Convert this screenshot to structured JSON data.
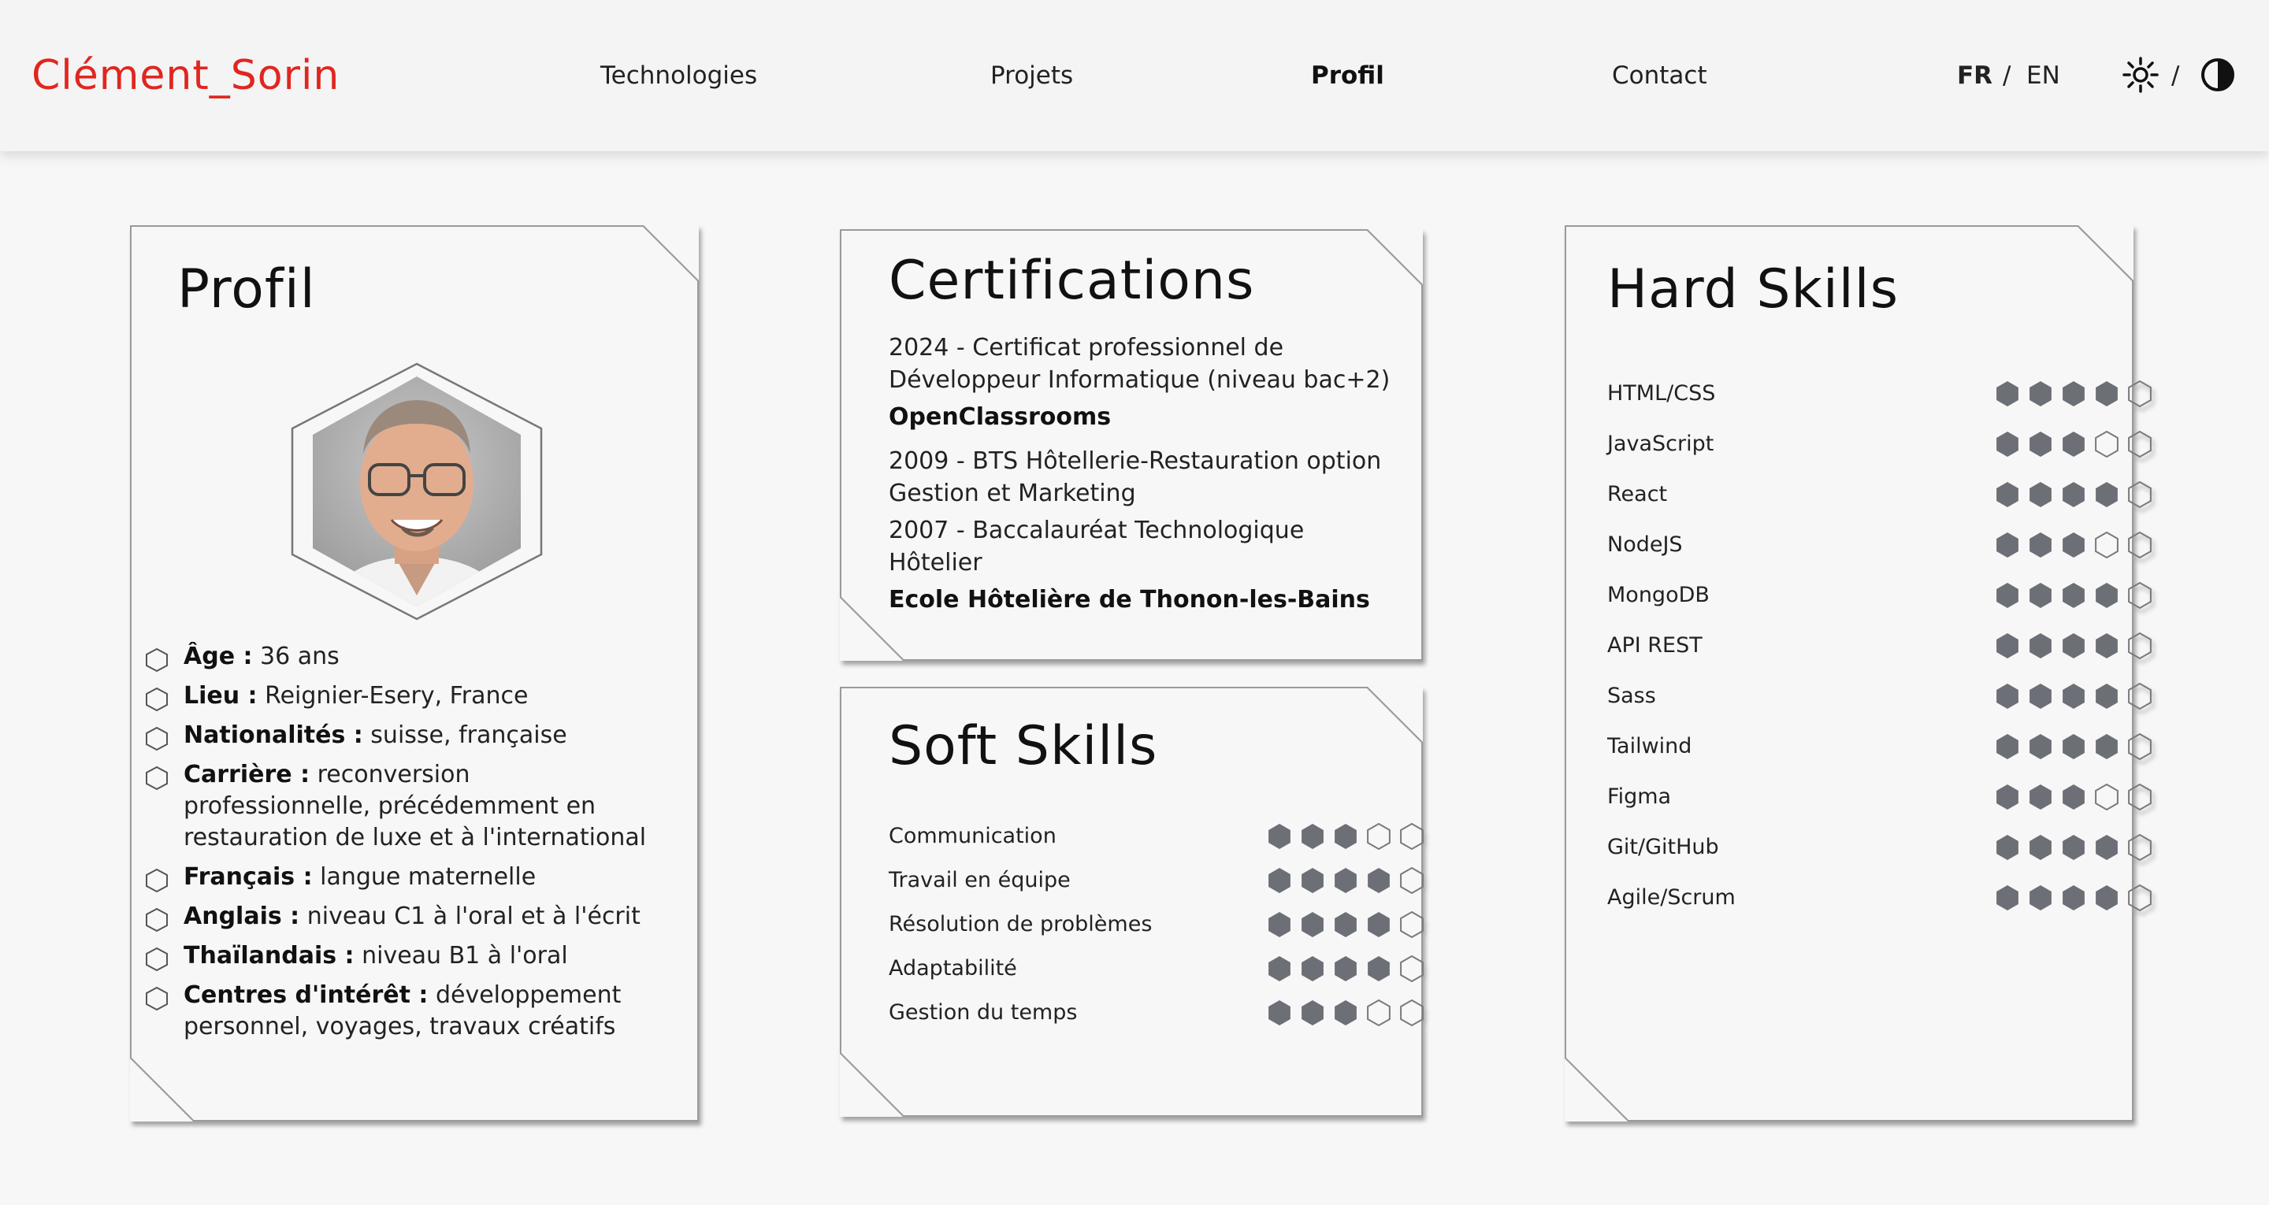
{
  "header": {
    "logo": "Clément_Sorin",
    "nav": [
      {
        "label": "Technologies",
        "active": false
      },
      {
        "label": "Projets",
        "active": false
      },
      {
        "label": "Profil",
        "active": true
      },
      {
        "label": "Contact",
        "active": false
      }
    ],
    "lang": {
      "fr": "FR",
      "sep": "/",
      "en": "EN",
      "active": "FR"
    },
    "theme_sep": "/",
    "theme_icons": [
      "sun-icon",
      "contrast-icon"
    ],
    "brand_color": "#e0261f"
  },
  "profile": {
    "title": "Profil",
    "photo_icon": "profile-photo",
    "items": [
      {
        "label": "Âge :",
        "value": "36 ans"
      },
      {
        "label": "Lieu :",
        "value": "Reignier-Esery, France"
      },
      {
        "label": "Nationalités :",
        "value": "suisse, française"
      },
      {
        "label": "Carrière :",
        "value": "reconversion professionnelle, précédemment en restauration de luxe et à l'international"
      },
      {
        "label": "Français :",
        "value": "langue maternelle"
      },
      {
        "label": "Anglais :",
        "value": "niveau C1 à l'oral et à l'écrit"
      },
      {
        "label": "Thaïlandais :",
        "value": "niveau B1 à l'oral"
      },
      {
        "label": "Centres d'intérêt :",
        "value": "développement personnel, voyages, travaux créatifs"
      }
    ]
  },
  "certifications": {
    "title": "Certifications",
    "entries": [
      {
        "text": "2024 - Certificat professionnel de Développeur Informatique (niveau bac+2)",
        "org": "OpenClassrooms"
      },
      {
        "text": "2009 - BTS Hôtellerie-Restauration option Gestion et Marketing",
        "org": ""
      },
      {
        "text": "2007 - Baccalauréat Technologique Hôtelier",
        "org": "Ecole Hôtelière de Thonon-les-Bains"
      }
    ]
  },
  "soft_skills": {
    "title": "Soft Skills",
    "items": [
      {
        "label": "Communication",
        "level": 3,
        "max": 5
      },
      {
        "label": "Travail en équipe",
        "level": 4,
        "max": 5
      },
      {
        "label": "Résolution de problèmes",
        "level": 4,
        "max": 5
      },
      {
        "label": "Adaptabilité",
        "level": 4,
        "max": 5
      },
      {
        "label": "Gestion du temps",
        "level": 3,
        "max": 5
      }
    ]
  },
  "hard_skills": {
    "title": "Hard Skills",
    "items": [
      {
        "label": "HTML/CSS",
        "level": 4,
        "max": 5
      },
      {
        "label": "JavaScript",
        "level": 3,
        "max": 5
      },
      {
        "label": "React",
        "level": 4,
        "max": 5
      },
      {
        "label": "NodeJS",
        "level": 3,
        "max": 5
      },
      {
        "label": "MongoDB",
        "level": 4,
        "max": 5
      },
      {
        "label": "API REST",
        "level": 4,
        "max": 5
      },
      {
        "label": "Sass",
        "level": 4,
        "max": 5
      },
      {
        "label": "Tailwind",
        "level": 4,
        "max": 5
      },
      {
        "label": "Figma",
        "level": 3,
        "max": 5
      },
      {
        "label": "Git/GitHub",
        "level": 4,
        "max": 5
      },
      {
        "label": "Agile/Scrum",
        "level": 4,
        "max": 5
      }
    ]
  },
  "colors": {
    "dot_filled": "#6d6f76",
    "dot_empty_stroke": "#7a7a7a",
    "card_bg": "#f7f7f7",
    "card_border": "#9a9a9a"
  }
}
